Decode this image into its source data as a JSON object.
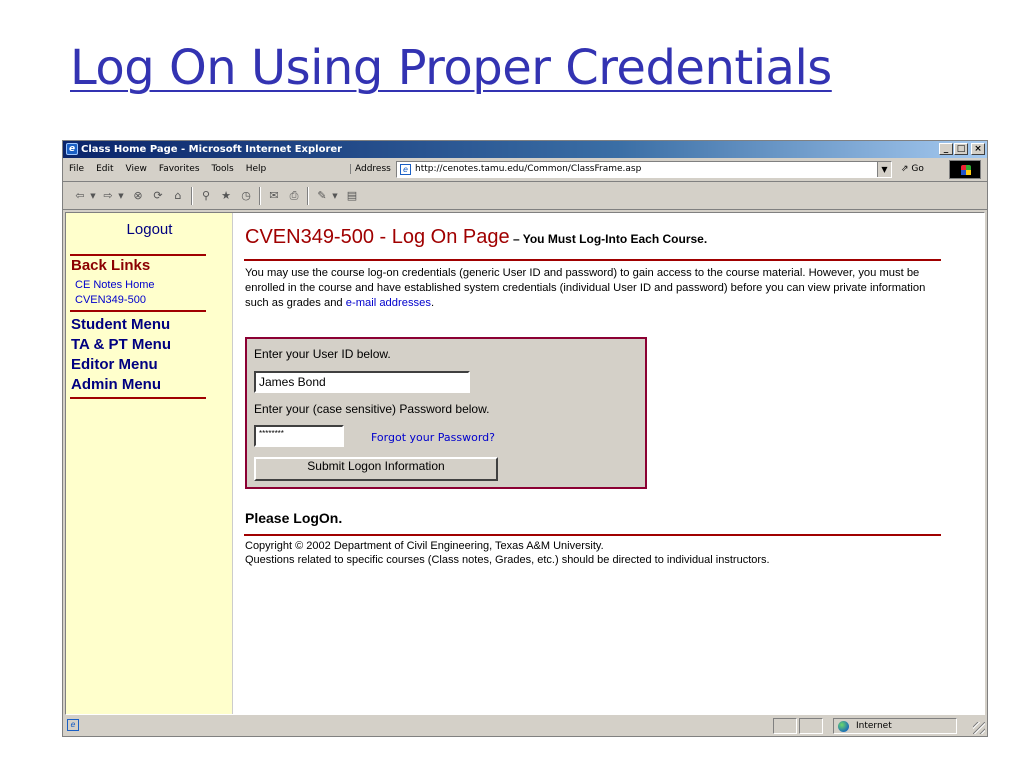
{
  "slide": {
    "title": "Log On Using Proper Credentials"
  },
  "window": {
    "title": "Class Home Page - Microsoft Internet Explorer",
    "buttons": {
      "minimize": "_",
      "maximize": "□",
      "close": "×"
    }
  },
  "menubar": {
    "items": [
      "File",
      "Edit",
      "View",
      "Favorites",
      "Tools",
      "Help"
    ],
    "address_label": "Address",
    "address_value": "http://cenotes.tamu.edu/Common/ClassFrame.asp",
    "go_label": "Go"
  },
  "toolbar": {
    "icons": [
      "back-icon",
      "forward-icon",
      "stop-icon",
      "refresh-icon",
      "home-icon",
      "search-icon",
      "favorites-icon",
      "history-icon",
      "mail-icon",
      "print-icon",
      "edit-icon",
      "discuss-icon"
    ]
  },
  "sidebar": {
    "logout": "Logout",
    "back_links_heading": "Back Links",
    "links": [
      "CE Notes Home",
      "CVEN349-500"
    ],
    "menus": [
      "Student Menu",
      "TA & PT Menu",
      "Editor Menu",
      "Admin Menu"
    ]
  },
  "main": {
    "heading": "CVEN349-500 - Log On Page",
    "tagline": " – You Must Log-Into Each Course.",
    "intro": "You may use the course log-on credentials (generic User ID and password) to gain access to the course material.  However, you must be enrolled in the course and have established system credentials (individual User ID and password) before you can view private information such as grades and ",
    "intro_link": "e-mail addresses",
    "intro_end": ".",
    "form": {
      "userid_label": "Enter your User ID below.",
      "userid_value": "James Bond",
      "password_label": "Enter your (case sensitive) Password below.",
      "password_value": "********",
      "forgot_label": "Forgot your Password?",
      "submit_label": "Submit Logon Information"
    },
    "status": "Please LogOn.",
    "footer_line1": "Copyright © 2002 Department of Civil Engineering, Texas A&M University.",
    "footer_line2": "Questions related to specific courses (Class notes, Grades, etc.) should be directed to individual instructors."
  },
  "statusbar": {
    "zone": "Internet"
  }
}
